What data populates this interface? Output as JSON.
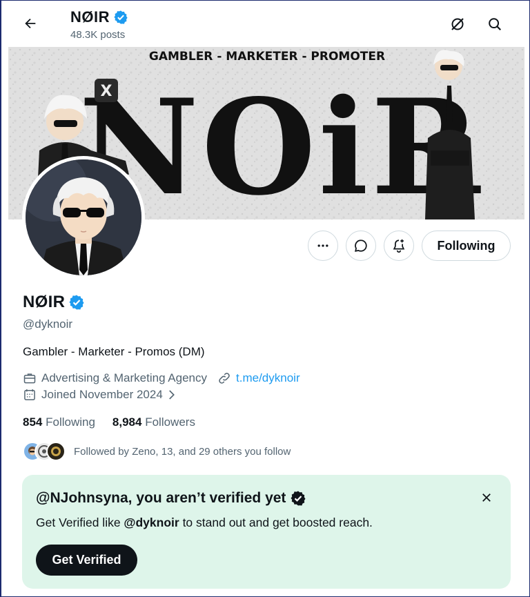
{
  "header": {
    "title": "NØIR",
    "posts": "48.3K posts"
  },
  "banner": {
    "tagline": "GAMBLER - MARKETER - PROMOTER",
    "logo_text": "NOiR",
    "x_badge": "X"
  },
  "actions": {
    "following_label": "Following"
  },
  "profile": {
    "name": "NØIR",
    "handle": "@dyknoir",
    "bio": "Gambler - Marketer - Promos (DM)",
    "category": "Advertising & Marketing Agency",
    "link": "t.me/dyknoir",
    "joined": "Joined November 2024",
    "following_count": "854",
    "following_label": "Following",
    "followers_count": "8,984",
    "followers_label": "Followers",
    "followed_by": "Followed by Zeno, 13, and 29 others you follow"
  },
  "verify": {
    "title": "@NJohnsyna, you aren’t verified yet",
    "desc_prefix": "Get Verified like ",
    "desc_handle": "@dyknoir",
    "desc_suffix": " to stand out and get boosted reach.",
    "button": "Get Verified"
  },
  "colors": {
    "accent": "#1d9bf0",
    "verify_bg": "#def5ea",
    "text_secondary": "#536471"
  }
}
